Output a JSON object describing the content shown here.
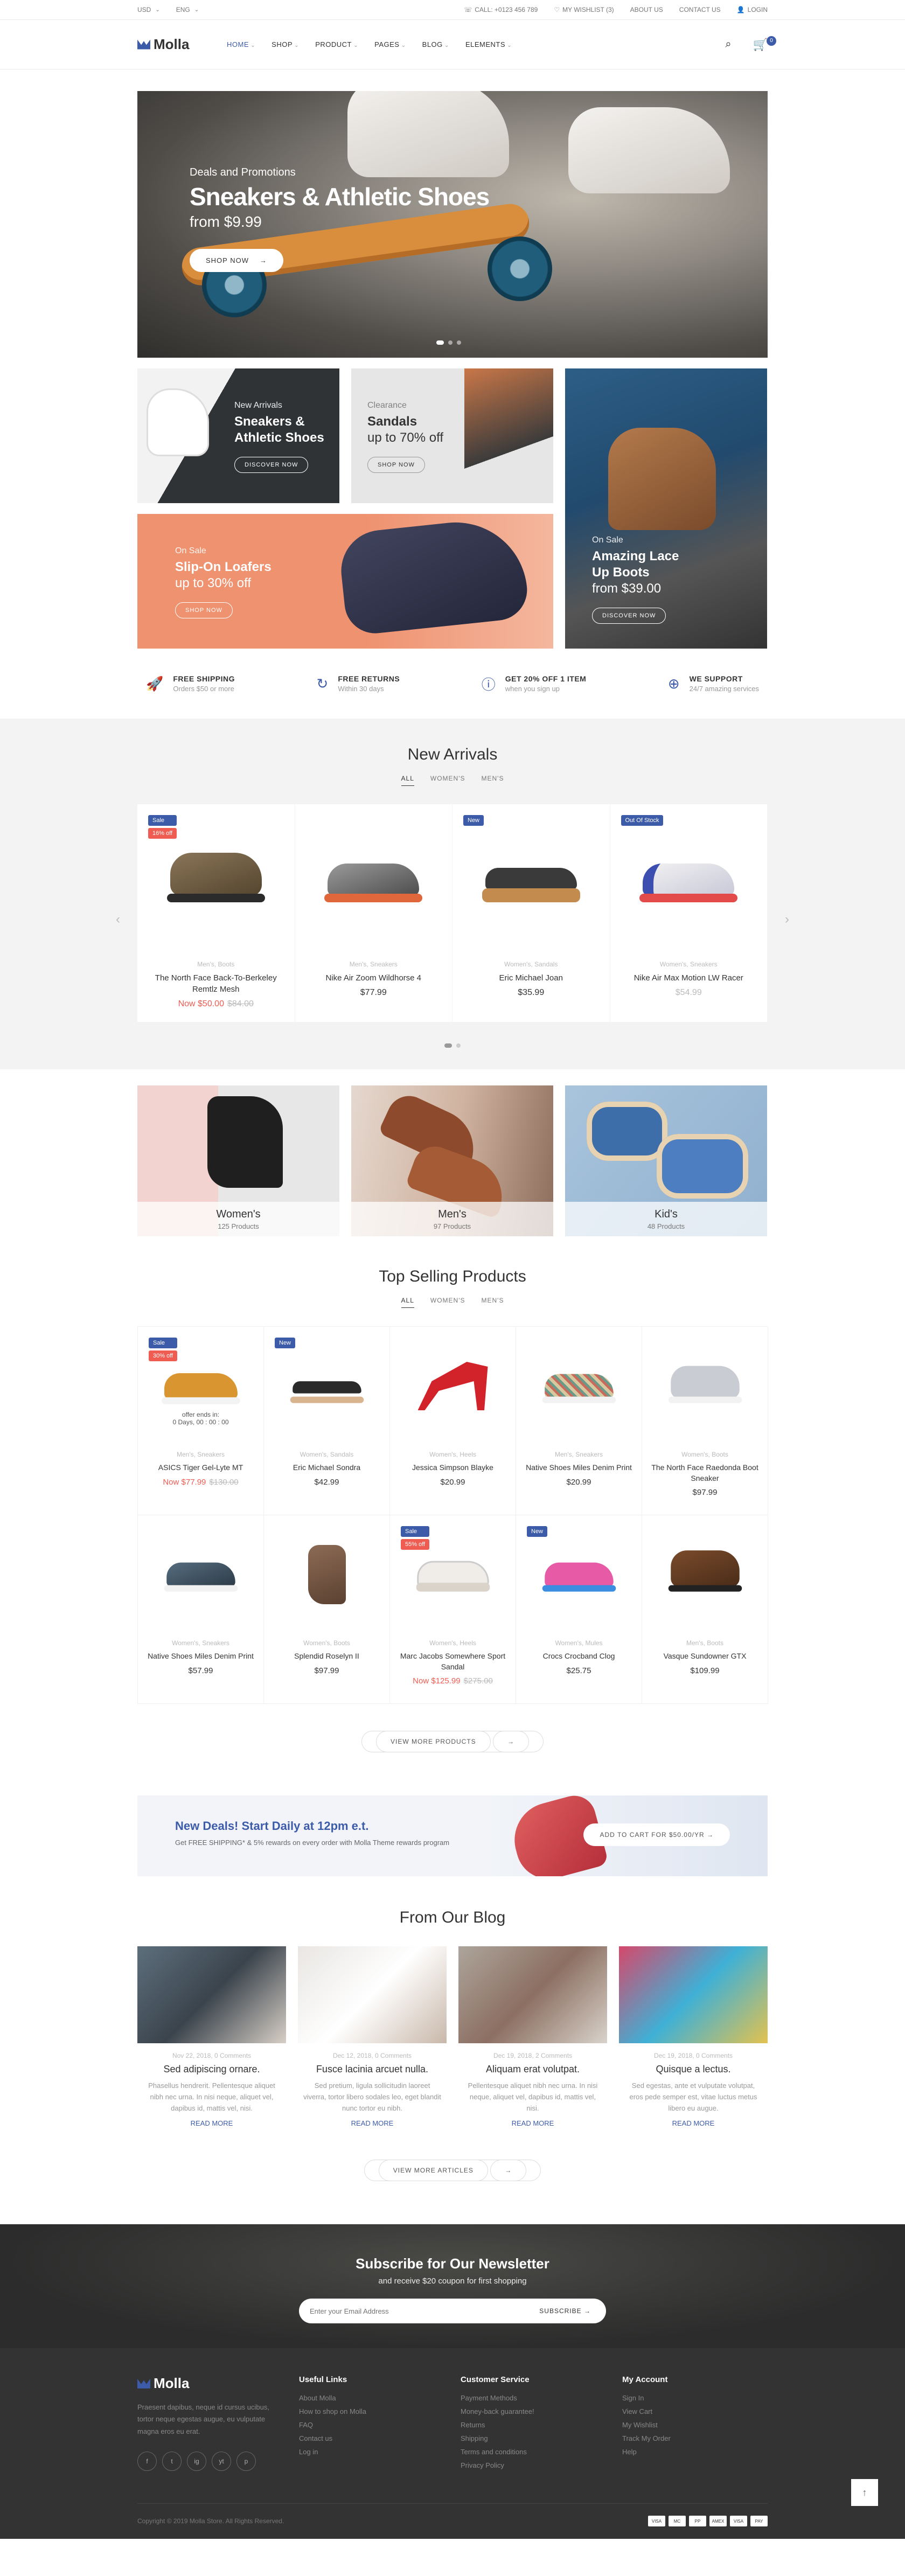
{
  "topbar": {
    "currency": "USD",
    "language": "ENG",
    "phone": "CALL: +0123 456 789",
    "wishlist": "MY WISHLIST (3)",
    "about": "ABOUT US",
    "contact": "CONTACT US",
    "login": "LOGIN"
  },
  "header": {
    "logo": "Molla",
    "nav": [
      "HOME",
      "SHOP",
      "PRODUCT",
      "PAGES",
      "BLOG",
      "ELEMENTS"
    ],
    "cart_count": "0"
  },
  "hero": {
    "subtitle": "Deals and Promotions",
    "title": "Sneakers & Athletic Shoes",
    "price": "from $9.99",
    "button": "SHOP NOW"
  },
  "banners": [
    {
      "label": "New Arrivals",
      "title": "Sneakers & Athletic Shoes",
      "button": "DISCOVER NOW"
    },
    {
      "label": "Clearance",
      "title": "Sandals",
      "title2": "up to 70% off",
      "button": "SHOP NOW"
    },
    {
      "label": "On Sale",
      "title": "Amazing Lace Up Boots",
      "title2": "from $39.00",
      "button": "DISCOVER NOW"
    },
    {
      "label": "On Sale",
      "title": "Slip-On Loafers",
      "title2": "up to 30% off",
      "button": "SHOP NOW"
    }
  ],
  "features": [
    {
      "title": "FREE SHIPPING",
      "text": "Orders $50 or more"
    },
    {
      "title": "FREE RETURNS",
      "text": "Within 30 days"
    },
    {
      "title": "GET 20% OFF 1 ITEM",
      "text": "when you sign up"
    },
    {
      "title": "WE SUPPORT",
      "text": "24/7 amazing services"
    }
  ],
  "new_arrivals": {
    "title": "New Arrivals",
    "tabs": [
      "ALL",
      "WOMEN'S",
      "MEN'S"
    ],
    "products": [
      {
        "cat": "Men's, Boots",
        "name": "The North Face Back-To-Berkeley Remtlz Mesh",
        "price_new": "Now $50.00",
        "price_old": "$84.00",
        "badge1": "Sale",
        "badge2": "16% off"
      },
      {
        "cat": "Men's, Sneakers",
        "name": "Nike Air Zoom Wildhorse 4",
        "price": "$77.99"
      },
      {
        "cat": "Women's, Sandals",
        "name": "Eric Michael Joan",
        "price": "$35.99",
        "badge1": "New"
      },
      {
        "cat": "Women's, Sneakers",
        "name": "Nike Air Max Motion LW Racer",
        "price": "$54.99",
        "badge1": "Out Of Stock"
      }
    ]
  },
  "categories": [
    {
      "name": "Women's",
      "count": "125 Products"
    },
    {
      "name": "Men's",
      "count": "97 Products"
    },
    {
      "name": "Kid's",
      "count": "48 Products"
    }
  ],
  "top_selling": {
    "title": "Top Selling Products",
    "tabs": [
      "ALL",
      "WOMEN'S",
      "MEN'S"
    ],
    "offer": "offer ends in:",
    "countdown": "0 Days, 00 : 00 : 00",
    "products": [
      {
        "cat": "Men's, Sneakers",
        "name": "ASICS Tiger Gel-Lyte MT",
        "price_new": "Now $77.99",
        "price_old": "$130.00",
        "badge1": "Sale",
        "badge2": "30% off"
      },
      {
        "cat": "Women's, Sandals",
        "name": "Eric Michael Sondra",
        "price": "$42.99",
        "badge1": "New"
      },
      {
        "cat": "Women's, Heels",
        "name": "Jessica Simpson Blayke",
        "price": "$20.99"
      },
      {
        "cat": "Men's, Sneakers",
        "name": "Native Shoes Miles Denim Print",
        "price": "$20.99"
      },
      {
        "cat": "Women's, Boots",
        "name": "The North Face Raedonda Boot Sneaker",
        "price": "$97.99"
      },
      {
        "cat": "Women's, Sneakers",
        "name": "Native Shoes Miles Denim Print",
        "price": "$57.99"
      },
      {
        "cat": "Women's, Boots",
        "name": "Splendid Roselyn II",
        "price": "$97.99"
      },
      {
        "cat": "Women's, Heels",
        "name": "Marc Jacobs Somewhere Sport Sandal",
        "price_new": "Now $125.99",
        "price_old": "$275.00",
        "badge1": "Sale",
        "badge2": "55% off"
      },
      {
        "cat": "Women's, Mules",
        "name": "Crocs Crocband Clog",
        "price": "$25.75",
        "badge1": "New"
      },
      {
        "cat": "Men's, Boots",
        "name": "Vasque Sundowner GTX",
        "price": "$109.99"
      }
    ],
    "more": "VIEW MORE PRODUCTS"
  },
  "deal": {
    "title": "New Deals! Start Daily at 12pm e.t.",
    "text": "Get FREE SHIPPING* & 5% rewards on every order with Molla Theme rewards program",
    "button": "ADD TO CART FOR $50.00/YR"
  },
  "blog": {
    "title": "From Our Blog",
    "posts": [
      {
        "meta": "Nov 22, 2018, 0 Comments",
        "title": "Sed adipiscing ornare.",
        "excerpt": "Phasellus hendrerit. Pellentesque aliquet nibh nec urna. In nisi neque, aliquet vel, dapibus id, mattis vel, nisi.",
        "read": "READ MORE"
      },
      {
        "meta": "Dec 12, 2018, 0 Comments",
        "title": "Fusce lacinia arcuet nulla.",
        "excerpt": "Sed pretium, ligula sollicitudin laoreet viverra, tortor libero sodales leo, eget blandit nunc tortor eu nibh.",
        "read": "READ MORE"
      },
      {
        "meta": "Dec 19, 2018, 2 Comments",
        "title": "Aliquam erat volutpat.",
        "excerpt": "Pellentesque aliquet nibh nec urna. In nisi neque, aliquet vel, dapibus id, mattis vel, nisi.",
        "read": "READ MORE"
      },
      {
        "meta": "Dec 19, 2018, 0 Comments",
        "title": "Quisque a lectus.",
        "excerpt": "Sed egestas, ante et vulputate volutpat, eros pede semper est, vitae luctus metus libero eu augue.",
        "read": "READ MORE"
      }
    ],
    "more": "VIEW MORE ARTICLES"
  },
  "newsletter": {
    "title": "Subscribe for Our Newsletter",
    "text": "and receive $20 coupon for first shopping",
    "placeholder": "Enter your Email Address",
    "button": "SUBSCRIBE"
  },
  "footer": {
    "logo": "Molla",
    "about": "Praesent dapibus, neque id cursus ucibus, tortor neque egestas augue, eu vulputate magna eros eu erat.",
    "social": [
      "f",
      "t",
      "ig",
      "yt",
      "p"
    ],
    "useful_title": "Useful Links",
    "useful": [
      "About Molla",
      "How to shop on Molla",
      "FAQ",
      "Contact us",
      "Log in"
    ],
    "service_title": "Customer Service",
    "service": [
      "Payment Methods",
      "Money-back guarantee!",
      "Returns",
      "Shipping",
      "Terms and conditions",
      "Privacy Policy"
    ],
    "account_title": "My Account",
    "account": [
      "Sign In",
      "View Cart",
      "My Wishlist",
      "Track My Order",
      "Help"
    ],
    "copyright": "Copyright © 2019 Molla Store. All Rights Reserved.",
    "payments": [
      "VISA",
      "MC",
      "PP",
      "AMEX",
      "VISA",
      "PAY"
    ]
  }
}
